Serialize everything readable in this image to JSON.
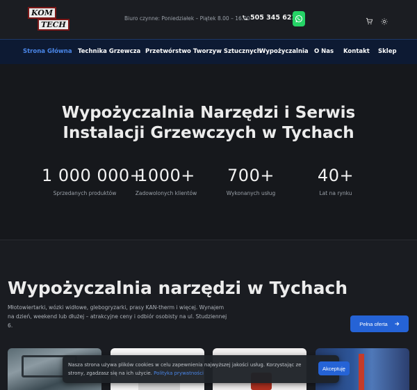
{
  "logo": {
    "line1": "KOM",
    "line2": "TECH"
  },
  "topbar": {
    "hours": "Biuro czynne: Poniedziałek – Piątek 8.00 – 16.00",
    "phone": "505 345 621"
  },
  "nav": {
    "items": [
      {
        "label": "Strona Główna",
        "active": true
      },
      {
        "label": "Technika Grzewcza"
      },
      {
        "label": "Przetwórstwo Tworzyw Sztucznych"
      },
      {
        "label": "Wypożyczalnia"
      },
      {
        "label": "O Nas"
      },
      {
        "label": "Kontakt"
      },
      {
        "label": "Sklep"
      }
    ]
  },
  "hero": {
    "title_line1": "Wypożyczalnia Narzędzi i Serwis",
    "title_line2": "Instalacji Grzewczych w Tychach",
    "stats": [
      {
        "value": "1 000 000+",
        "label": "Sprzedanych produktów"
      },
      {
        "value": "1000+",
        "label": "Zadowolonych klientów"
      },
      {
        "value": "700+",
        "label": "Wykonanych usług"
      },
      {
        "value": "40+",
        "label": "Lat na rynku"
      }
    ]
  },
  "rental": {
    "title": "Wypożyczalnia narzędzi w Tychach",
    "description": "Młotowiertarki, wózki widłowe, glebogryzarki, prasy KAN-therm i więcej. Wynajem na dzień, weekend lub dłużej – atrakcyjne ceny i odbiór osobisty na ul. Studziennej 6.",
    "button_label": "Pełna oferta"
  },
  "cookie": {
    "text": "Nasza strona używa plików cookies w celu zapewnienia najwyższej jakości usług. Korzystając ze strony, zgadzasz się na ich użycie.",
    "link": "Polityka prywatności",
    "accept_label": "Akceptuję"
  },
  "colors": {
    "accent": "#2563d6",
    "nav_active": "#4a86e8",
    "nav_bg": "#0d1a33",
    "whatsapp": "#25d366"
  }
}
